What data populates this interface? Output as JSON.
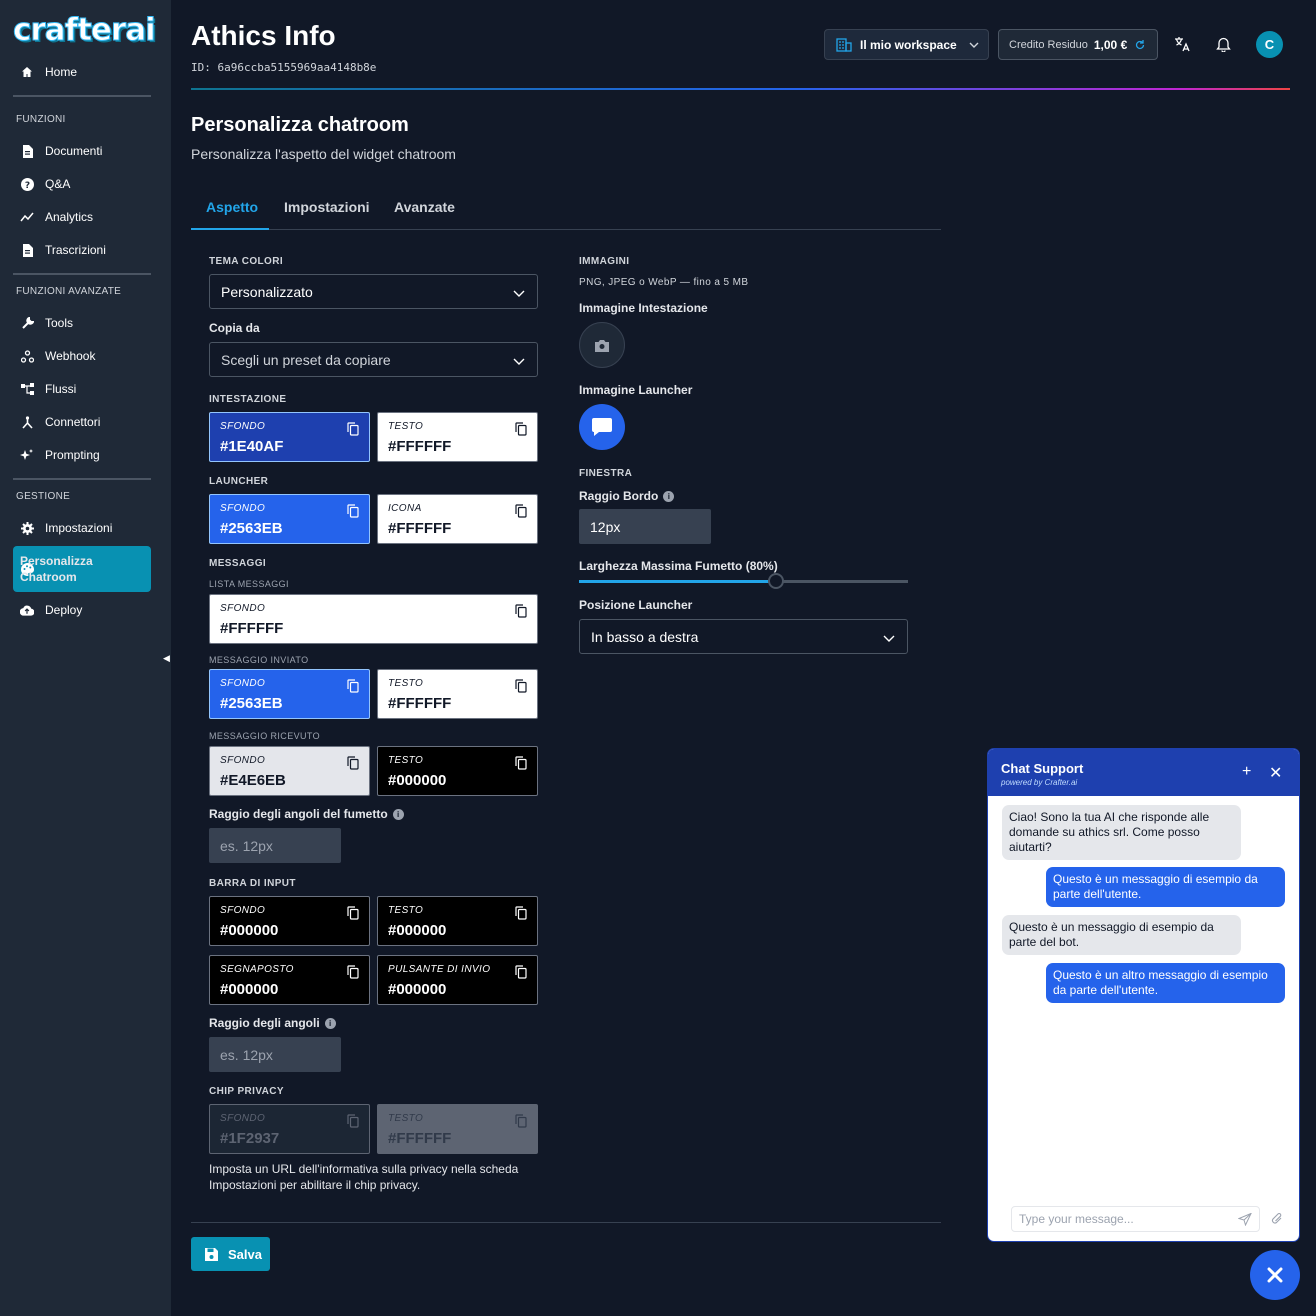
{
  "brand": {
    "logo_main": "crafter",
    "logo_ai": "ai"
  },
  "sidebar": {
    "home": "Home",
    "sections": [
      "FUNZIONI",
      "FUNZIONI AVANZATE",
      "GESTIONE"
    ],
    "funzioni": [
      "Documenti",
      "Q&A",
      "Analytics",
      "Trascrizioni"
    ],
    "avanzate": [
      "Tools",
      "Webhook",
      "Flussi",
      "Connettori",
      "Prompting"
    ],
    "gestione": [
      "Impostazioni",
      "Personalizza",
      "Chatroom",
      "Deploy"
    ]
  },
  "header": {
    "title": "Athics Info",
    "id": "ID: 6a96ccba5155969aa4148b8e",
    "workspace": "Il mio workspace",
    "credit_label": "Credito Residuo",
    "credit_value": "1,00 €",
    "avatar": "C"
  },
  "page": {
    "title": "Personalizza chatroom",
    "subtitle": "Personalizza l'aspetto del widget chatroom"
  },
  "tabs": [
    "Aspetto",
    "Impostazioni",
    "Avanzate"
  ],
  "left": {
    "tema_label": "TEMA COLORI",
    "tema_value": "Personalizzato",
    "copia_label": "Copia da",
    "copia_placeholder": "Scegli un preset da copiare",
    "intestazione": "INTESTAZIONE",
    "launcher": "LAUNCHER",
    "messaggi": "MESSAGGI",
    "lista_messaggi": "LISTA MESSAGGI",
    "messaggio_inviato": "MESSAGGIO INVIATO",
    "messaggio_ricevuto": "MESSAGGIO RICEVUTO",
    "raggio_fumetto": "Raggio degli angoli del fumetto",
    "raggio_placeholder": "es. 12px",
    "barra_input": "BARRA DI INPUT",
    "raggio_angoli": "Raggio degli angoli",
    "chip_privacy": "CHIP PRIVACY",
    "privacy_note": "Imposta un URL dell'informativa sulla privacy nella scheda Impostazioni per abilitare il chip privacy.",
    "save": "Salva"
  },
  "swatches": [
    {
      "key": "SFONDO",
      "value": "#1E40AF",
      "bg": "#1E40AF",
      "fg": "#FFFFFF"
    },
    {
      "key": "TESTO",
      "value": "#FFFFFF",
      "bg": "#FFFFFF",
      "fg": "#111827"
    },
    {
      "key": "SFONDO",
      "value": "#2563EB",
      "bg": "#2563EB",
      "fg": "#FFFFFF"
    },
    {
      "key": "ICONA",
      "value": "#FFFFFF",
      "bg": "#FFFFFF",
      "fg": "#111827"
    },
    {
      "key": "SFONDO",
      "value": "#FFFFFF",
      "bg": "#FFFFFF",
      "fg": "#111827"
    },
    {
      "key": "SFONDO",
      "value": "#2563EB",
      "bg": "#2563EB",
      "fg": "#FFFFFF"
    },
    {
      "key": "TESTO",
      "value": "#FFFFFF",
      "bg": "#FFFFFF",
      "fg": "#111827"
    },
    {
      "key": "SFONDO",
      "value": "#E4E6EB",
      "bg": "#E4E6EB",
      "fg": "#111827"
    },
    {
      "key": "TESTO",
      "value": "#000000",
      "bg": "#000000",
      "fg": "#FFFFFF"
    },
    {
      "key": "SFONDO",
      "value": "#000000",
      "bg": "#000000",
      "fg": "#FFFFFF"
    },
    {
      "key": "TESTO",
      "value": "#000000",
      "bg": "#000000",
      "fg": "#FFFFFF"
    },
    {
      "key": "SEGNAPOSTO",
      "value": "#000000",
      "bg": "#000000",
      "fg": "#FFFFFF"
    },
    {
      "key": "PULSANTE DI INVIO",
      "value": "#000000",
      "bg": "#000000",
      "fg": "#FFFFFF"
    },
    {
      "key": "SFONDO",
      "value": "#1F2937",
      "bg": "#1F2937",
      "fg": "#6B7280"
    },
    {
      "key": "TESTO",
      "value": "#FFFFFF",
      "bg": "#6B7280",
      "fg": "#374151"
    }
  ],
  "right": {
    "immagini": "IMMAGINI",
    "formats": "PNG, JPEG o WebP — fino a 5 MB",
    "img_header": "Immagine Intestazione",
    "img_launcher": "Immagine Launcher",
    "finestra": "FINESTRA",
    "raggio_bordo": "Raggio Bordo",
    "raggio_bordo_value": "12px",
    "larghezza": "Larghezza Massima Fumetto (80%)",
    "larghezza_percent": 60,
    "posizione": "Posizione Launcher",
    "posizione_value": "In basso a destra"
  },
  "chat": {
    "title": "Chat Support",
    "subtitle": "powered by Crafter.ai",
    "messages": [
      "Ciao! Sono la tua AI che risponde alle domande su athics srl. Come posso aiutarti?",
      "Questo è un messaggio di esempio da parte dell'utente.",
      "Questo è un messaggio di esempio da parte del bot.",
      "Questo è un altro messaggio di esempio da parte dell'utente."
    ],
    "placeholder": "Type your message..."
  }
}
